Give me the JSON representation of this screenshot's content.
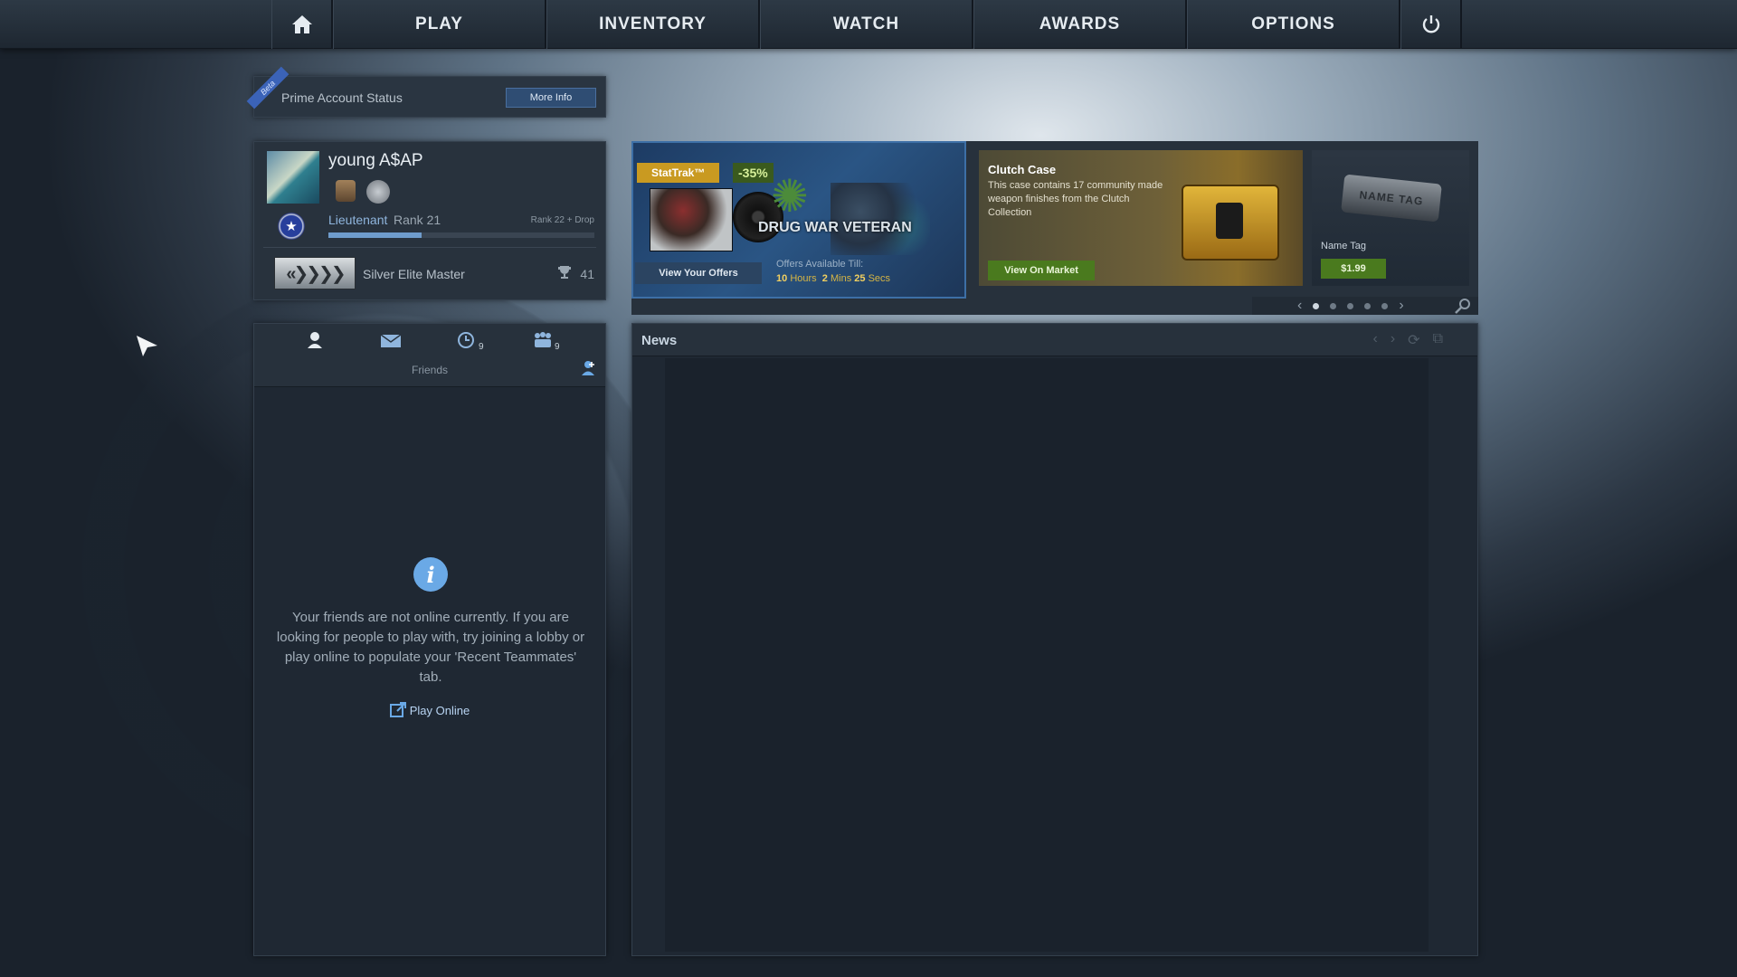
{
  "nav": {
    "items": [
      {
        "label": "PLAY"
      },
      {
        "label": "INVENTORY"
      },
      {
        "label": "WATCH"
      },
      {
        "label": "AWARDS"
      },
      {
        "label": "OPTIONS"
      }
    ],
    "home_icon": "home-icon",
    "power_icon": "power-icon"
  },
  "prime": {
    "beta": "Beta",
    "label": "Prime Account Status",
    "more_info": "More Info"
  },
  "profile": {
    "username": "young A$AP",
    "rank_title": "Lieutenant",
    "rank": "Rank 21",
    "next_rank": "Rank 22 + Drop",
    "xp_progress": 0.35,
    "skill_group": "Silver Elite Master",
    "trophies": "41"
  },
  "friends": {
    "tabs": [
      {
        "icon": "person-icon",
        "count": ""
      },
      {
        "icon": "mail-icon",
        "count": ""
      },
      {
        "icon": "clock-icon",
        "count": "9"
      },
      {
        "icon": "group-icon",
        "count": "9"
      }
    ],
    "title": "Friends",
    "message": "Your friends are not online currently.  If you are looking for people to play with, try joining a lobby or play online to populate your 'Recent Teammates' tab.",
    "play_online": "Play Online"
  },
  "store": {
    "operation": {
      "stattrak": "StatTrak™",
      "discount": "-35%",
      "title": "DRUG WAR VETERAN",
      "button": "View Your Offers",
      "offers_till": "Offers Available Till:",
      "hours": "10",
      "hours_label": "Hours",
      "mins": "2",
      "mins_label": "Mins",
      "secs": "25",
      "secs_label": "Secs"
    },
    "case": {
      "title": "Clutch Case",
      "description": "This case contains 17 community made weapon finishes from the Clutch Collection",
      "button": "View On Market"
    },
    "name_tag": {
      "image_text": "NAME TAG",
      "label": "Name Tag",
      "price": "$1.99"
    },
    "carousel": {
      "pages": 5,
      "active": 1
    }
  },
  "news": {
    "title": "News"
  },
  "colors": {
    "accent_blue": "#6f9ccc",
    "market_green": "#4a7a1e",
    "stattrak_orange": "#c99a21"
  }
}
